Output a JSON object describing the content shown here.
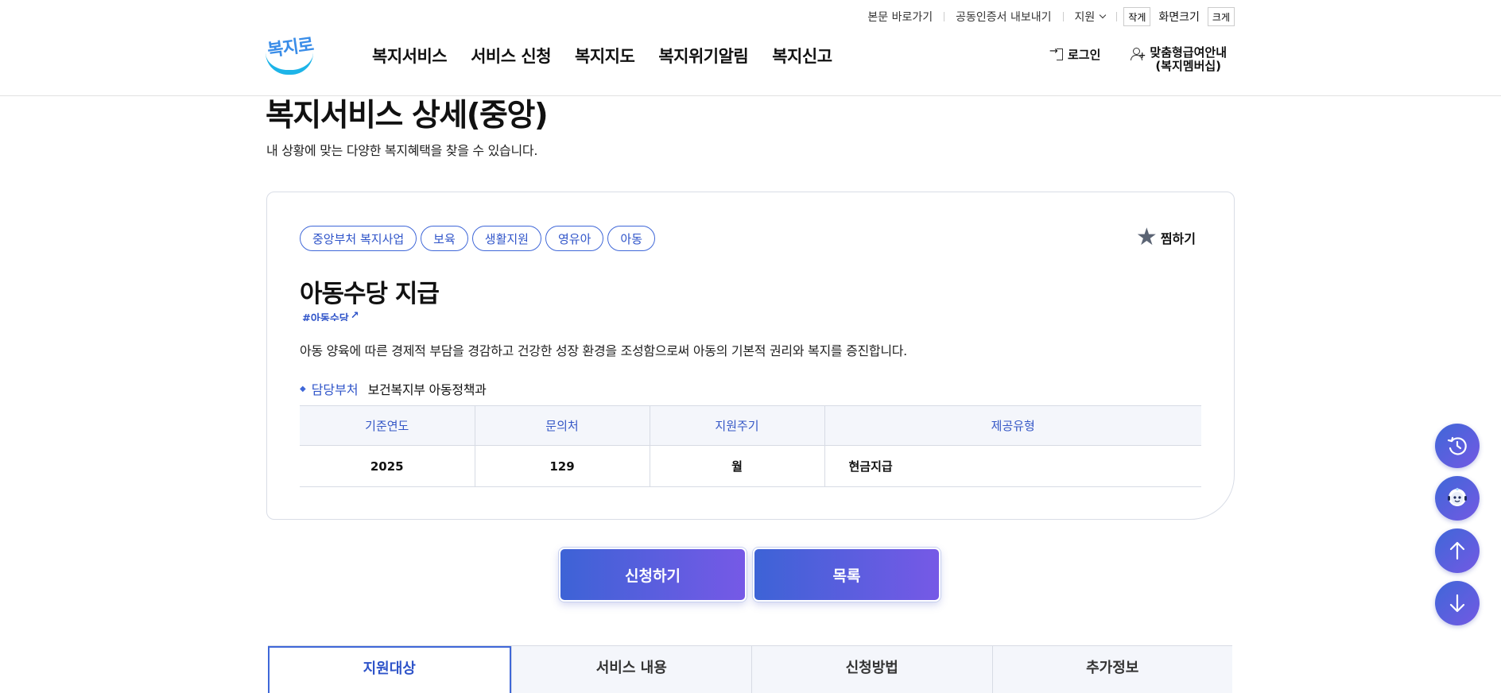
{
  "util_bar": {
    "skip_link": "본문 바로가기",
    "cert_export": "공동인증서 내보내기",
    "language": "지원",
    "font_small": "작게",
    "font_label": "화면크기",
    "font_large": "크게"
  },
  "header": {
    "logo_text": "복지로",
    "nav": [
      "복지서비스",
      "서비스 신청",
      "복지지도",
      "복지위기알림",
      "복지신고"
    ],
    "login": "로그인",
    "membership_line1": "맞춤형급여안내",
    "membership_line2": "(복지멤버십)"
  },
  "page": {
    "title": "복지서비스 상세(중앙)",
    "subtitle": "내 상황에 맞는 다양한 복지혜택을 찾을 수 있습니다."
  },
  "service": {
    "tags": [
      "중앙부처 복지사업",
      "보육",
      "생활지원",
      "영유아",
      "아동"
    ],
    "bookmark": "찜하기",
    "title": "아동수당 지급",
    "hashtag": "#아동수당",
    "description": "아동 양육에 따른 경제적 부담을 경감하고 건강한 성장 환경을 조성함으로써 아동의 기본적 권리와 복지를 증진합니다.",
    "dept_label": "담당부처",
    "dept_value": "보건복지부 아동정책과",
    "table": {
      "headers": [
        "기준연도",
        "문의처",
        "지원주기",
        "제공유형"
      ],
      "row": [
        "2025",
        "129",
        "월",
        "현금지급"
      ]
    }
  },
  "actions": {
    "apply": "신청하기",
    "list": "목록"
  },
  "tabs": [
    "지원대상",
    "서비스 내용",
    "신청방법",
    "추가정보"
  ],
  "floating": {
    "icons": [
      "history-icon",
      "chatbot-icon",
      "arrow-up-icon",
      "arrow-down-icon"
    ]
  },
  "colors": {
    "accent": "#3f67d8",
    "accent_end": "#7659e6",
    "tag_text": "#2f54c9"
  }
}
